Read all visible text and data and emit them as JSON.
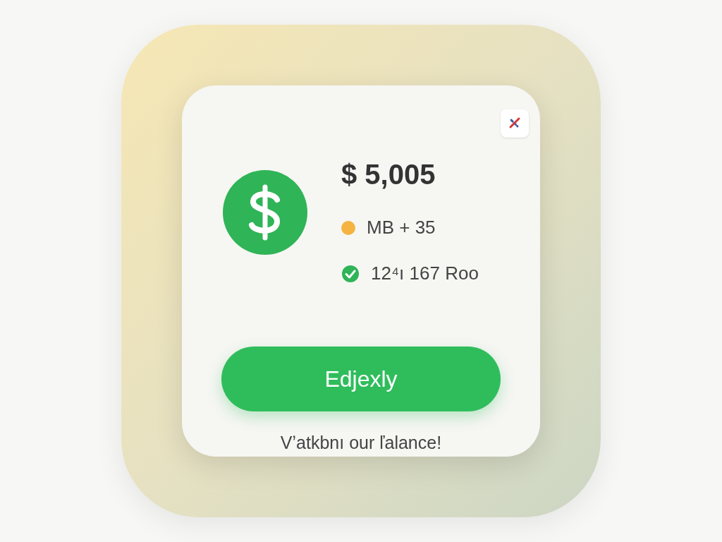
{
  "balance": {
    "amount": "$ 5,005"
  },
  "items": [
    {
      "kind": "dot",
      "color": "#f5b342",
      "text": "MB + 35"
    },
    {
      "kind": "check",
      "text": "12⁴ı 167 Roo"
    }
  ],
  "button": {
    "label": "Edjexly"
  },
  "footer": "Vʼatkbnı our ľalance!"
}
